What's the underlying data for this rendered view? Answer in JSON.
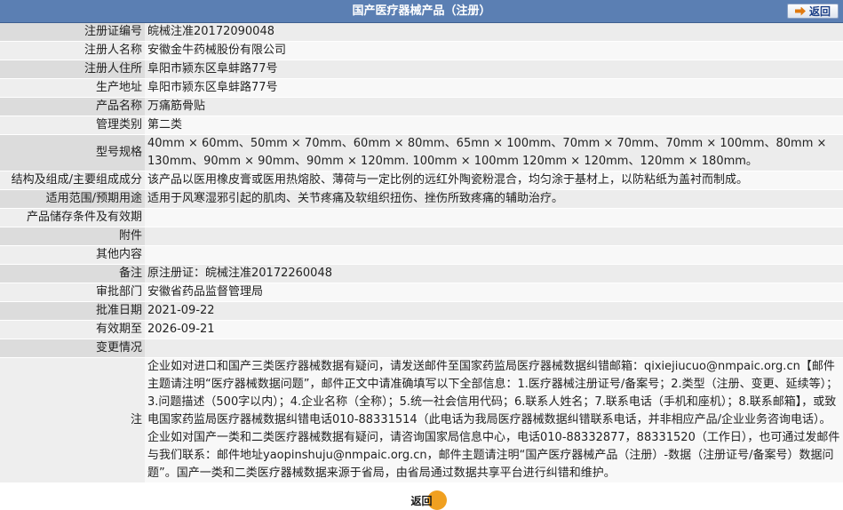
{
  "header": {
    "title": "国产医疗器械产品（注册）",
    "back_label": "返回"
  },
  "rows": [
    {
      "label": "注册证编号",
      "value": "皖械注准20172090048"
    },
    {
      "label": "注册人名称",
      "value": "安徽金牛药械股份有限公司"
    },
    {
      "label": "注册人住所",
      "value": "阜阳市颍东区阜蚌路77号"
    },
    {
      "label": "生产地址",
      "value": "阜阳市颍东区阜蚌路77号"
    },
    {
      "label": "产品名称",
      "value": "万痛筋骨贴"
    },
    {
      "label": "管理类别",
      "value": "第二类"
    },
    {
      "label": "型号规格",
      "value": "40mm × 60mm、50mm × 70mm、60mm × 80mm、65mn × 100mm、70mm × 70mm、70mm × 100mm、80mm × 130mm、90mm × 90mm、90mm × 120mm. 100mm × 100mm 120mm × 120mm、120mm × 180mm。"
    },
    {
      "label": "结构及组成/主要组成成分",
      "value": "该产品以医用橡皮膏或医用热熔胶、薄荷与一定比例的远红外陶瓷粉混合，均匀涂于基材上，以防粘纸为盖衬而制成。"
    },
    {
      "label": "适用范围/预期用途",
      "value": "适用于风寒湿邪引起的肌肉、关节疼痛及软组织扭伤、挫伤所致疼痛的辅助治疗。"
    },
    {
      "label": "产品储存条件及有效期",
      "value": ""
    },
    {
      "label": "附件",
      "value": ""
    },
    {
      "label": "其他内容",
      "value": ""
    },
    {
      "label": "备注",
      "value": "原注册证：皖械注准20172260048"
    },
    {
      "label": "审批部门",
      "value": "安徽省药品监督管理局"
    },
    {
      "label": "批准日期",
      "value": "2021-09-22"
    },
    {
      "label": "有效期至",
      "value": "2026-09-21"
    },
    {
      "label": "变更情况",
      "value": ""
    }
  ],
  "note": {
    "label": "注",
    "text": "企业如对进口和国产三类医疗器械数据有疑问，请发送邮件至国家药监局医疗器械数据纠错邮箱：qixiejiucuo@nmpaic.org.cn【邮件主题请注明“医疗器械数据问题”，邮件正文中请准确填写以下全部信息：1.医疗器械注册证号/备案号；2.类型（注册、变更、延续等）；3.问题描述（500字以内）；4.企业名称（全称）；5.统一社会信用代码；6.联系人姓名；7.联系电话（手机和座机）；8.联系邮箱】，或致电国家药监局医疗器械数据纠错电话010-88331514（此电话为我局医疗器械数据纠错联系电话，并非相应产品/企业业务咨询电话）。企业如对国产一类和二类医疗器械数据有疑问，请咨询国家局信息中心，电话010-88332877，88331520（工作日），也可通过发邮件与我们联系：邮件地址yaopinshuju@nmpaic.org.cn，邮件主题请注明“国产医疗器械产品（注册）-数据（注册证号/备案号）数据问题”。国产一类和二类医疗器械数据来源于省局，由省局通过数据共享平台进行纠错和维护。"
  },
  "footer": {
    "back_label": "返回"
  },
  "colors": {
    "header_bg": "#5b7fb3",
    "label_bg": "#dcdcdc",
    "value_bg": "#ececec",
    "accent": "#f0a020"
  }
}
